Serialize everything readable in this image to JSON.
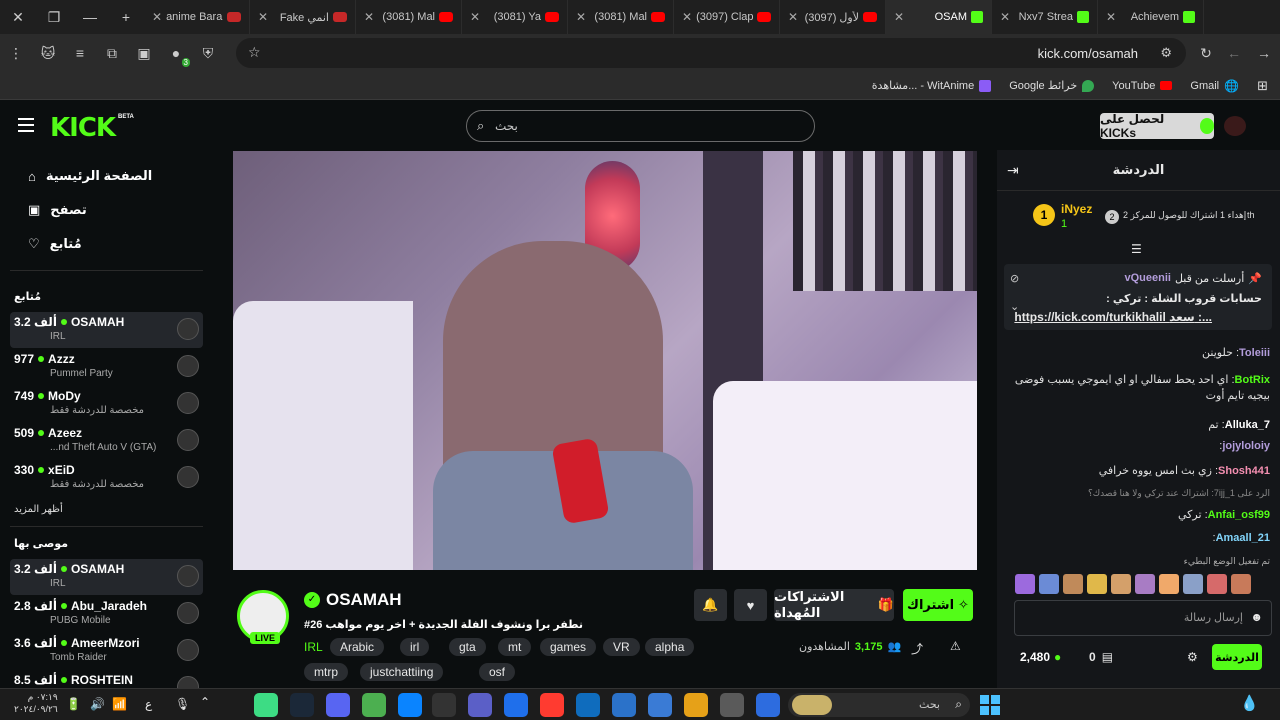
{
  "browser": {
    "tabs": [
      {
        "title": "Achievem",
        "favicon": "kick"
      },
      {
        "title": "Nxv7 Strea",
        "favicon": "kick"
      },
      {
        "title": "OSAM",
        "favicon": "kick",
        "active": true
      },
      {
        "title": "(3097) لأول",
        "favicon": "youtube"
      },
      {
        "title": "(3097) Clap",
        "favicon": "youtube"
      },
      {
        "title": "(3081) Mal",
        "favicon": "youtube"
      },
      {
        "title": "(3081) Ya",
        "favicon": "youtube"
      },
      {
        "title": "(3081) Mal",
        "favicon": "youtube"
      },
      {
        "title": "Fake انمي",
        "favicon": "top"
      },
      {
        "title": "anime Baraku",
        "favicon": "top"
      }
    ],
    "url": "kick.com/osamah",
    "extension_badge": "3",
    "bookmarks": [
      "Gmail",
      "YouTube",
      "Google خرائط",
      "مشاهدة... - WitAnime"
    ]
  },
  "header": {
    "logo": "KICK",
    "beta": "BETA",
    "search_placeholder": "بحث",
    "get_kicks": "لحصل على KICKs"
  },
  "sidebar": {
    "nav": [
      {
        "label": "الصفحة الرئيسية",
        "icon": "home-icon"
      },
      {
        "label": "تصفح",
        "icon": "browse-icon"
      },
      {
        "label": "مُتابع",
        "icon": "heart-icon"
      }
    ],
    "following_title": "مُتابع",
    "following": [
      {
        "name": "OSAMAH",
        "viewers": "3.2 ألف",
        "category": "IRL"
      },
      {
        "name": "Azzz",
        "viewers": "977",
        "category": "Pummel Party"
      },
      {
        "name": "MoDy",
        "viewers": "749",
        "category": "مخصصة للدردشة فقط"
      },
      {
        "name": "Azeez",
        "viewers": "509",
        "category": "...nd Theft Auto V (GTA)"
      },
      {
        "name": "xEiD",
        "viewers": "330",
        "category": "مخصصة للدردشة فقط"
      }
    ],
    "show_more": "أظهر المزيد",
    "recommended_title": "موصى بها",
    "recommended": [
      {
        "name": "OSAMAH",
        "viewers": "3.2 ألف",
        "category": "IRL"
      },
      {
        "name": "Abu_Jaradeh",
        "viewers": "2.8 ألف",
        "category": "PUBG Mobile"
      },
      {
        "name": "AmeerMzori",
        "viewers": "3.6 ألف",
        "category": "Tomb Raider"
      },
      {
        "name": "ROSHTEIN",
        "viewers": "8.5 ألف",
        "category": ""
      }
    ]
  },
  "stream": {
    "channel": "OSAMAH",
    "live_badge": "LIVE",
    "title": "نطفر برا ونشوف الفلة الجديدة + اخر يوم مواهب 26#",
    "tags": [
      "IRL",
      "Arabic",
      "irl",
      "gta",
      "mt",
      "games",
      "VR",
      "alpha",
      "mtrp",
      "justchattiing",
      "osf"
    ],
    "viewers_label": "المشاهدون",
    "viewers": "3,175",
    "subscribe": "اشتراك",
    "gifted_subs": "الاشتراكات المُهداة"
  },
  "chat": {
    "title": "الدردشة",
    "gift_leader": {
      "user": "iNyez",
      "rank": "1",
      "count": "1",
      "text": "إهداء 1 اشتراك للوصول للمركز 2",
      "rank_next": "2",
      "suffix": "th"
    },
    "pinned": {
      "user": "vQueenii",
      "label": "أرسلت من قبل",
      "line1": "حسابات قروب الشلة : تركي :",
      "line2": "https://kick.com/turkikhalil سعد :..."
    },
    "messages": [
      {
        "user": "Toleiii",
        "text": "حلوينن",
        "color": "#b39ddb"
      },
      {
        "user": "BotRix",
        "text": "اي احد يحط سفالي او اي ايموجي يسبب فوضى بيجيه تايم أوت",
        "color": "#53fc18"
      },
      {
        "user": "Alluka_7",
        "text": "تم",
        "color": "#ffffff"
      },
      {
        "user": "jojyloloiy",
        "text": "",
        "color": "#b39ddb"
      },
      {
        "user": "Shosh441",
        "text": "زي بث امس يووه خرافي",
        "color": "#f48fb1"
      },
      {
        "user": "",
        "text": "الرد على 7ijj_1: اشتراك عند تركي ولا هنا قصدك؟",
        "color": "#888888"
      },
      {
        "user": "Anfai_osf99",
        "text": "تركي",
        "color": "#53fc18"
      },
      {
        "user": "Amaall_21",
        "text": "",
        "color": "#81d4fa"
      }
    ],
    "slow_mode": "تم تفعيل الوضع البطيء",
    "input_placeholder": "إرسال رسالة",
    "points": "2,480",
    "kicks": "0",
    "send": "الدردشة"
  },
  "taskbar": {
    "search_placeholder": "بحث",
    "time": "٠٧:١٩ م",
    "date": "٢٠٢٤/٠٩/٢٦",
    "lang": "ع"
  },
  "colors": {
    "accent": "#53fc18",
    "bg": "#0b0e0f",
    "chat_bg": "#141619"
  }
}
